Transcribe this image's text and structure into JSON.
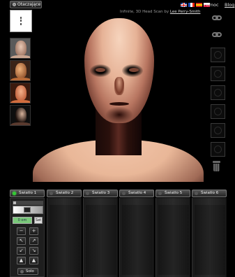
{
  "top_bar": {
    "mode_dropdown": "Otaczające",
    "help_label": "Pomoc",
    "blog_label": "Blog",
    "flags": [
      "en-flag-icon",
      "fr-flag-icon",
      "es-flag-icon",
      "pl-flag-icon"
    ]
  },
  "credit": {
    "prefix": "Infinite, 3D Head Scan by",
    "author": "Lee Perry-Smith"
  },
  "presets": {
    "thumb_count": 4
  },
  "lights": {
    "tabs": [
      {
        "label": "Światło 1",
        "active": true
      },
      {
        "label": "Światło 2",
        "active": false
      },
      {
        "label": "Światło 3",
        "active": false
      },
      {
        "label": "Światło 4",
        "active": false
      },
      {
        "label": "Światło 5",
        "active": false
      },
      {
        "label": "Światło 6",
        "active": false
      }
    ],
    "color_value": "0 om",
    "set_label": "Set",
    "minus_label": "−",
    "plus_label": "+",
    "solo_label": "Solo"
  },
  "colors": {
    "background": "#000000",
    "active_led": "#33cc33",
    "swatch": "#7ac87a"
  }
}
